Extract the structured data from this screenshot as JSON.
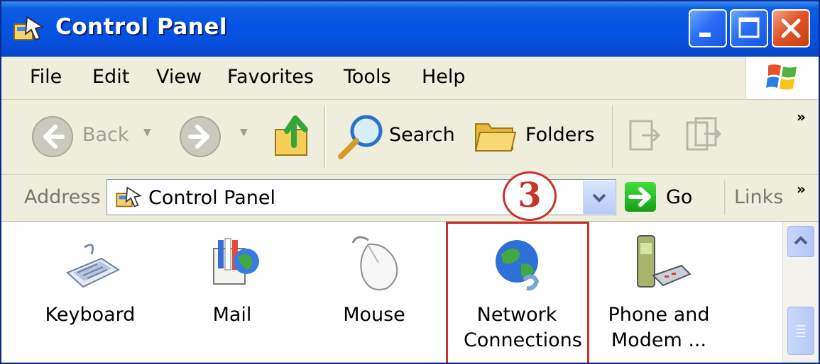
{
  "window": {
    "title": "Control Panel",
    "controls": [
      "minimize",
      "maximize",
      "close"
    ]
  },
  "menubar": {
    "items": [
      "File",
      "Edit",
      "View",
      "Favorites",
      "Tools",
      "Help"
    ]
  },
  "toolbar": {
    "back_label": "Back",
    "search_label": "Search",
    "folders_label": "Folders",
    "overflow": "»"
  },
  "addressbar": {
    "label": "Address",
    "value": "Control Panel",
    "go_label": "Go",
    "links_label": "Links",
    "overflow": "»"
  },
  "annotation": {
    "step_number": "3",
    "color": "#c8332a"
  },
  "content": {
    "items": [
      {
        "line1": "Keyboard",
        "line2": "",
        "icon": "keyboard-icon"
      },
      {
        "line1": "Mail",
        "line2": "",
        "icon": "mail-icon"
      },
      {
        "line1": "Mouse",
        "line2": "",
        "icon": "mouse-icon"
      },
      {
        "line1": "Network",
        "line2": "Connections",
        "icon": "network-connections-icon"
      },
      {
        "line1": "Phone and",
        "line2": "Modem ...",
        "icon": "phone-modem-icon"
      }
    ]
  },
  "colors": {
    "titlebar": "#0554e3",
    "chrome": "#efeddb",
    "highlight": "#c8332a"
  }
}
